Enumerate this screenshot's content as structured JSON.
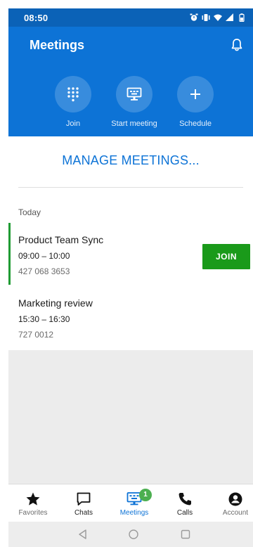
{
  "status_bar": {
    "time": "08:50",
    "icons": [
      "alarm-icon",
      "vibrate-icon",
      "wifi-icon",
      "signal-icon",
      "battery-icon"
    ]
  },
  "header": {
    "title": "Meetings",
    "actions": [
      {
        "label": "Join",
        "icon": "dialpad-icon"
      },
      {
        "label": "Start meeting",
        "icon": "screen-share-icon"
      },
      {
        "label": "Schedule",
        "icon": "plus-icon"
      }
    ]
  },
  "manage": {
    "label": "MANAGE MEETINGS..."
  },
  "list": {
    "section": "Today",
    "meetings": [
      {
        "title": "Product Team Sync",
        "time": "09:00 – 10:00",
        "id": "427 068 3653",
        "join_label": "JOIN"
      },
      {
        "title": "Marketing review",
        "time": "15:30 – 16:30",
        "id": "727 0012"
      }
    ]
  },
  "nav": {
    "items": [
      {
        "label": "Favorites",
        "icon": "star-icon"
      },
      {
        "label": "Chats",
        "icon": "chat-icon"
      },
      {
        "label": "Meetings",
        "icon": "meetings-icon",
        "badge": "1",
        "active": true
      },
      {
        "label": "Calls",
        "icon": "phone-icon"
      },
      {
        "label": "Account",
        "icon": "account-icon"
      }
    ]
  },
  "colors": {
    "header": "#0d73d6",
    "status_bar": "#0b62b7",
    "accent_green": "#1a9a1a",
    "link_blue": "#0d73d6"
  }
}
